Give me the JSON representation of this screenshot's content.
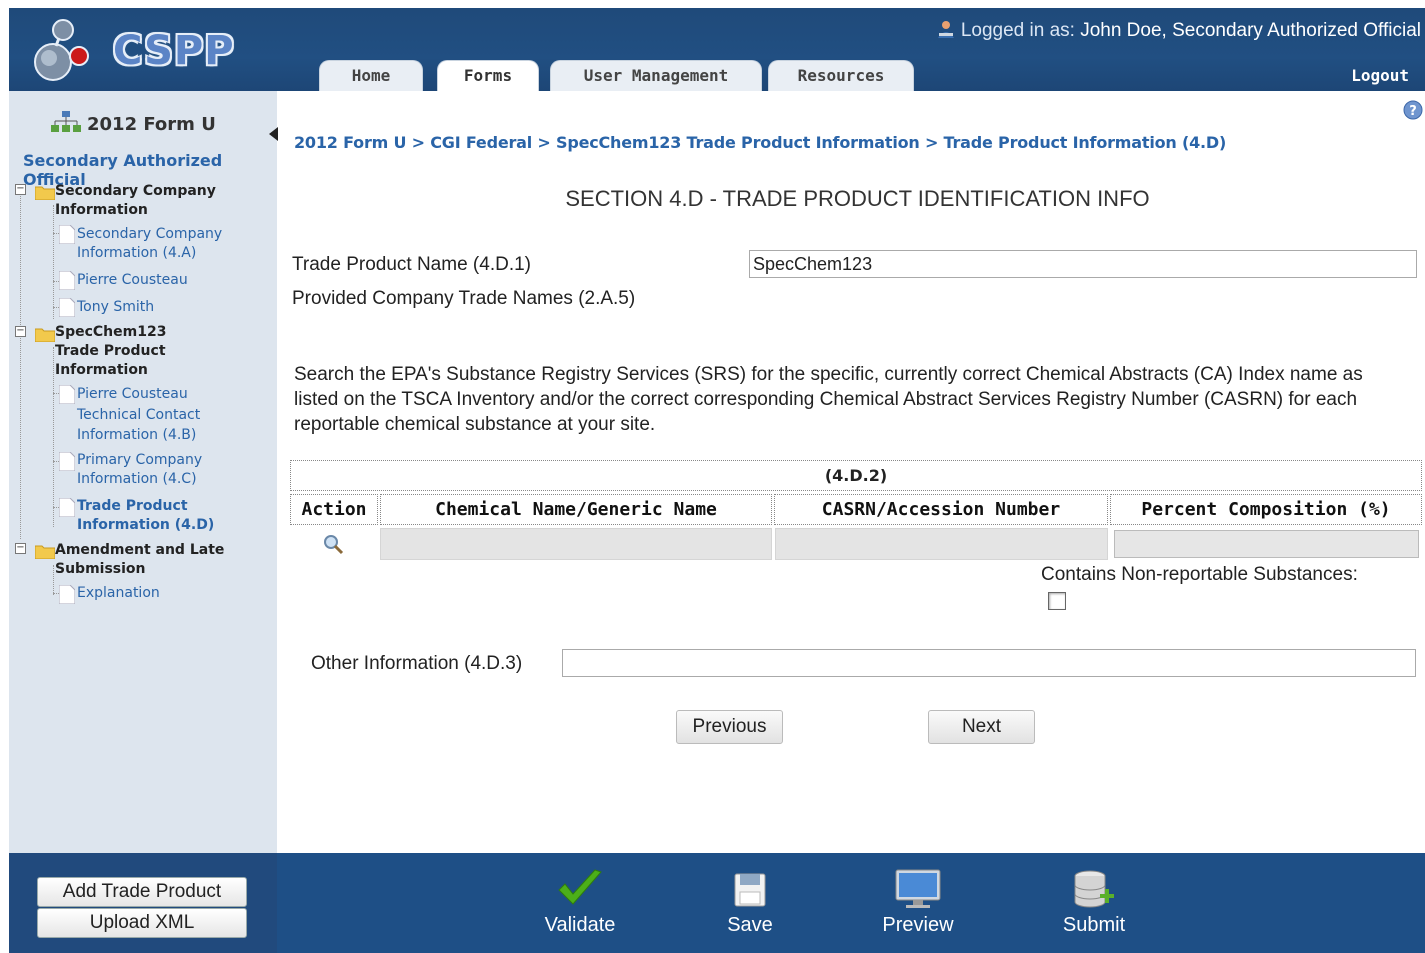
{
  "header": {
    "app_name": "CSPP",
    "logged_in_label": "Logged in as:",
    "user_name": "John Doe, Secondary Authorized Official",
    "logout": "Logout",
    "tabs": [
      {
        "label": "Home",
        "active": false
      },
      {
        "label": "Forms",
        "active": true
      },
      {
        "label": "User Management",
        "active": false
      },
      {
        "label": "Resources",
        "active": false
      }
    ]
  },
  "sidebar": {
    "form_title": "2012 Form U",
    "role": "Secondary Authorized Official",
    "tree": {
      "folder1": {
        "line1": "Secondary Company",
        "line2": "Information"
      },
      "leaf1": {
        "line1": "Secondary Company",
        "line2": "Information (4.A)"
      },
      "leaf2": "Pierre Cousteau",
      "leaf3": "Tony Smith",
      "folder2": {
        "line1": "SpecChem123",
        "line2": "Trade Product",
        "line3": "Information"
      },
      "leaf4": {
        "line1": "Pierre Cousteau",
        "line2": "Technical Contact",
        "line3": "Information (4.B)"
      },
      "leaf5": {
        "line1": "Primary Company",
        "line2": "Information (4.C)"
      },
      "leaf6": {
        "line1": "Trade Product",
        "line2": "Information (4.D)"
      },
      "folder3": {
        "line1": "Amendment and Late",
        "line2": "Submission"
      },
      "leaf7": "Explanation"
    },
    "buttons": {
      "add_trade_product": "Add Trade Product",
      "upload_xml": "Upload XML"
    }
  },
  "breadcrumb": "2012 Form U > CGI Federal > SpecChem123 Trade Product Information > Trade Product Information (4.D)",
  "main": {
    "section_title": "SECTION 4.D - TRADE PRODUCT IDENTIFICATION INFO",
    "trade_product_name_label": "Trade Product Name (4.D.1)",
    "trade_product_name_value": "SpecChem123",
    "provided_trade_names_label": "Provided Company Trade Names (2.A.5)",
    "instructions": "Search the EPA's Substance Registry Services (SRS) for the specific, currently correct Chemical Abstracts (CA) Index name as listed on the TSCA Inventory and/or the correct corresponding Chemical Abstract Services Registry Number (CASRN) for each reportable chemical substance at your site.",
    "grid": {
      "caption": "(4.D.2)",
      "columns": [
        "Action",
        "Chemical Name/Generic Name",
        "CASRN/Accession Number",
        "Percent Composition (%)"
      ]
    },
    "non_reportable_label": "Contains Non-reportable Substances:",
    "non_reportable_checked": false,
    "other_info_label": "Other Information (4.D.3)",
    "other_info_value": "",
    "previous": "Previous",
    "next": "Next"
  },
  "bottom_actions": {
    "validate": "Validate",
    "save": "Save",
    "preview": "Preview",
    "submit": "Submit"
  },
  "colors": {
    "header_bg": "#214f82",
    "sidebar_bg": "#dde5ee",
    "link": "#2a64a8",
    "bottom_bar": "#1e4f86",
    "validate_check": "#4caf1a"
  }
}
